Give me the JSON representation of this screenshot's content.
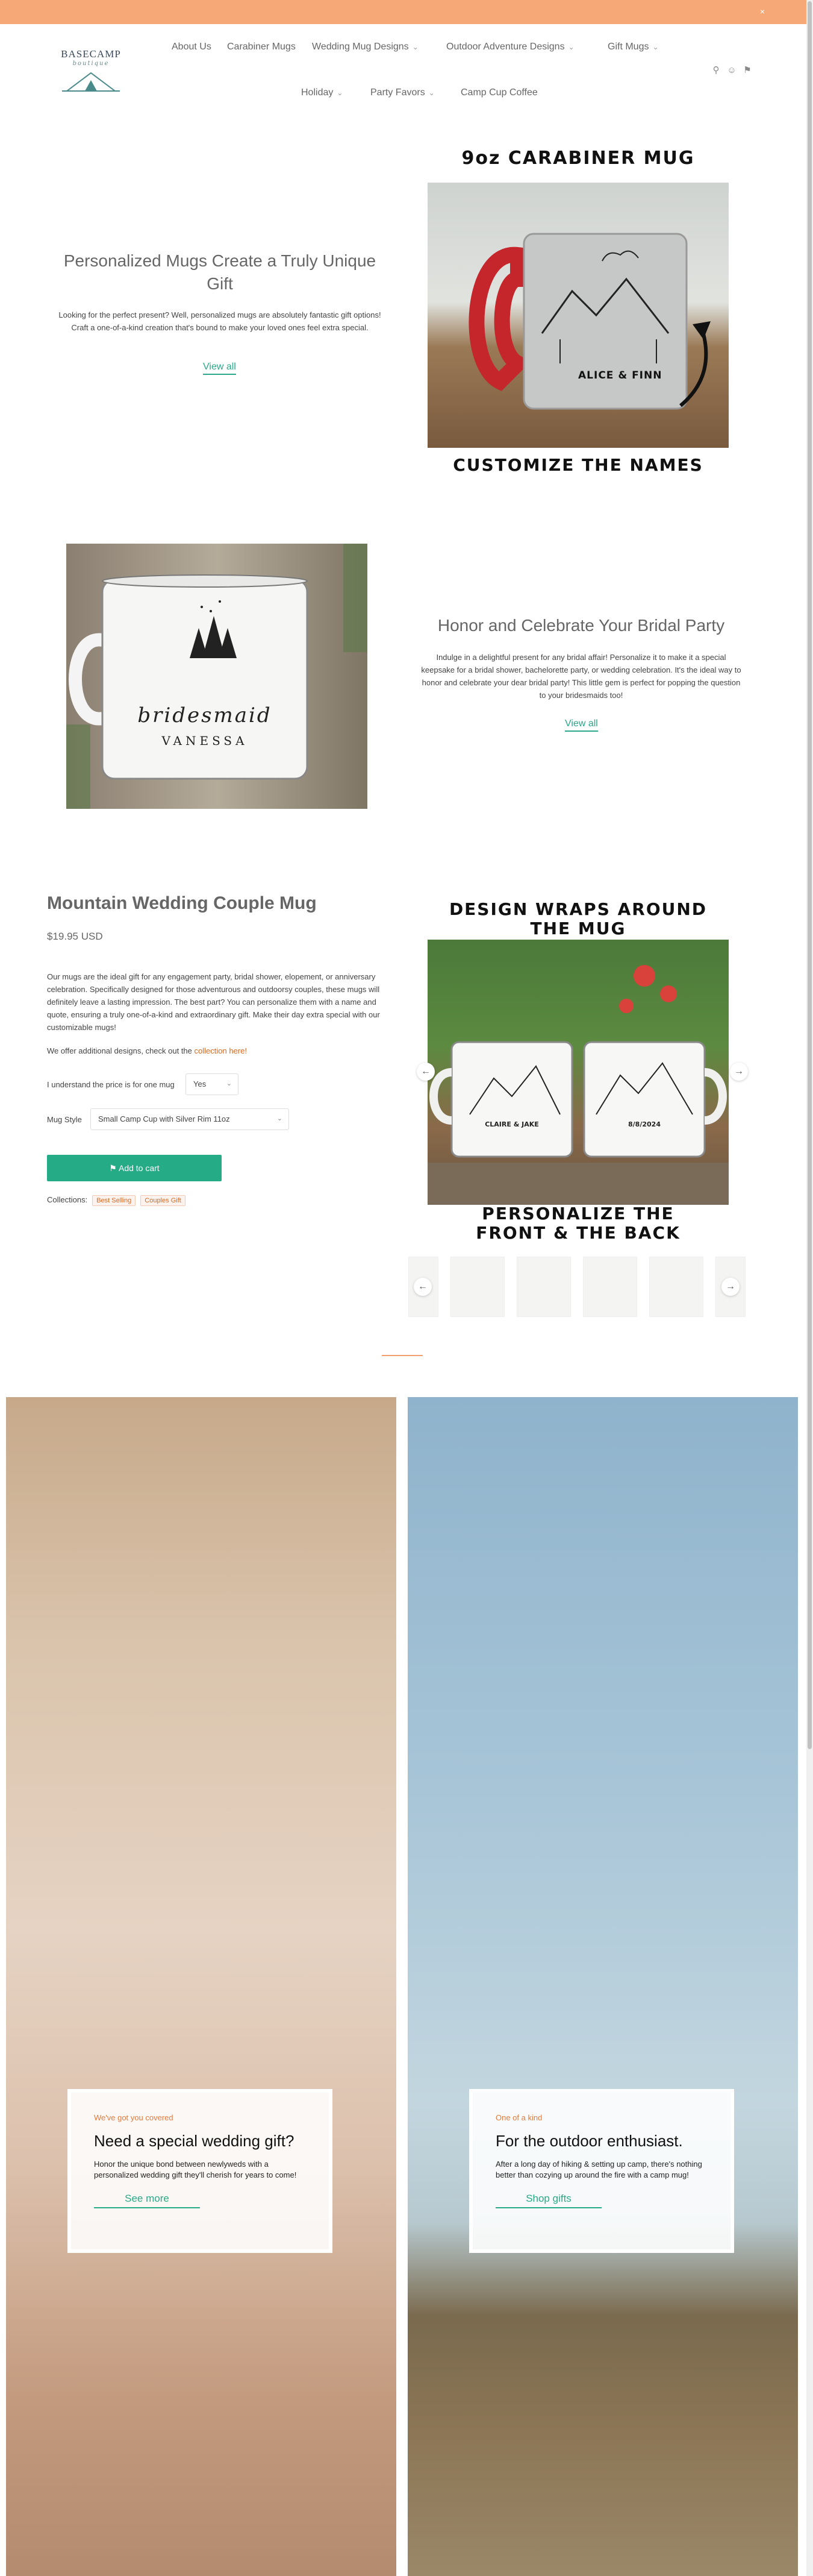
{
  "header": {
    "logo_name": "BASECAMP",
    "logo_sub": "boutique",
    "nav_row1": [
      {
        "label": "About Us"
      },
      {
        "label": "Carabiner Mugs"
      },
      {
        "label": "Wedding Mug Designs",
        "chevron": "chevron-down-icon"
      },
      {
        "label": "Outdoor Adventure Designs",
        "chevron": "chevron-down-icon"
      },
      {
        "label": "Gift Mugs",
        "chevron": "chevron-down-icon"
      }
    ],
    "nav_row2": [
      {
        "label": "Holiday",
        "chevron": "chevron-down-icon"
      },
      {
        "label": "Party Favors",
        "chevron": "chevron-down-icon"
      },
      {
        "label": "Camp Cup Coffee"
      }
    ],
    "icons": [
      "search-icon",
      "user-icon",
      "cart-icon"
    ],
    "close_glyph": "×"
  },
  "section1": {
    "title": "Personalized Mugs Create a Truly Unique Gift",
    "body": "Looking for the perfect present? Well, personalized mugs are absolutely fantastic gift options! Craft a one-of-a-kind creation that's bound to make your loved ones feel extra special.",
    "link": "View all",
    "promo_top": "9oz CARABINER MUG",
    "promo_bottom": "CUSTOMIZE THE NAMES",
    "mug_names": "ALICE & FINN"
  },
  "section2": {
    "title": "Honor and Celebrate Your Bridal Party",
    "body": "Indulge in a delightful present for any bridal affair! Personalize it to make it a special keepsake for a bridal shower, bachelorette party, or wedding celebration. It's the ideal way to honor and celebrate your dear bridal party! This little gem is perfect for popping the question to your bridesmaids too!",
    "link": "View all",
    "mug_script": "bridesmaid",
    "mug_name": "VANESSA"
  },
  "product": {
    "title": "Mountain Wedding Couple Mug",
    "price": "$19.95 USD",
    "description": "Our mugs are the ideal gift for any engagement party, bridal shower, elopement, or anniversary celebration. Specifically designed for those adventurous and outdoorsy couples, these mugs will definitely leave a lasting impression. The best part? You can personalize them with a name and quote, ensuring a truly one-of-a-kind and extraordinary gift. Make their day extra special with our customizable mugs!",
    "more_prefix": "We offer additional designs, check out the",
    "more_link": "collection here!",
    "option1_label": "I understand the price is for one mug",
    "option1_value": "Yes",
    "option2_label": "Mug Style",
    "option2_value": "Small Camp Cup with Silver Rim 11oz",
    "add_to_cart": "Add to cart",
    "collections_label": "Collections:",
    "collections": [
      "Best Selling",
      "Couples Gift"
    ],
    "promo_top": "DESIGN WRAPS AROUND THE MUG",
    "promo_bottom": "PERSONALIZE THE FRONT & THE BACK",
    "mug_left_text": "CLAIRE & JAKE",
    "mug_right_text": "8/8/2024"
  },
  "features": [
    {
      "eyebrow": "We've got you covered",
      "title": "Need a special wedding gift?",
      "text": "Honor the unique bond between newlyweds with a personalized wedding gift they'll cherish for years to come!",
      "link": "See more"
    },
    {
      "eyebrow": "One of a kind",
      "title": "For the outdoor enthusiast.",
      "text": "After a long day of hiking & setting up camp, there's nothing better than cozying up around the fire with a camp mug!",
      "link": "Shop gifts"
    }
  ],
  "colors": {
    "announce_bar": "#f6a877",
    "accent_green": "#26ab87",
    "accent_orange": "#d9681f"
  }
}
